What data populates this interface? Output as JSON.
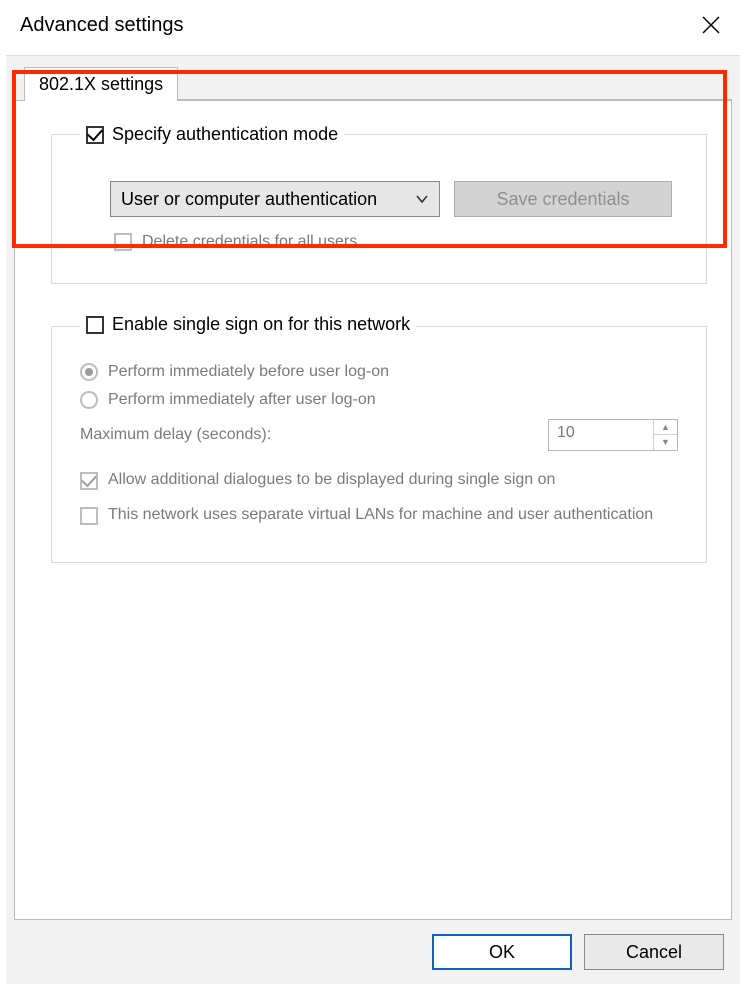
{
  "dialog": {
    "title": "Advanced settings",
    "tab_label": "802.1X settings",
    "ok_label": "OK",
    "cancel_label": "Cancel"
  },
  "auth": {
    "specify_mode_label": "Specify authentication mode",
    "mode_selected": "User or computer authentication",
    "save_credentials_label": "Save credentials",
    "delete_credentials_label": "Delete credentials for all users"
  },
  "sso": {
    "enable_label": "Enable single sign on for this network",
    "perform_before_label": "Perform immediately before user log-on",
    "perform_after_label": "Perform immediately after user log-on",
    "max_delay_label": "Maximum delay (seconds):",
    "max_delay_value": "10",
    "allow_dialogues_label": "Allow additional dialogues to be displayed during single sign on",
    "separate_vlan_label": "This network uses separate virtual LANs for machine and user authentication"
  }
}
